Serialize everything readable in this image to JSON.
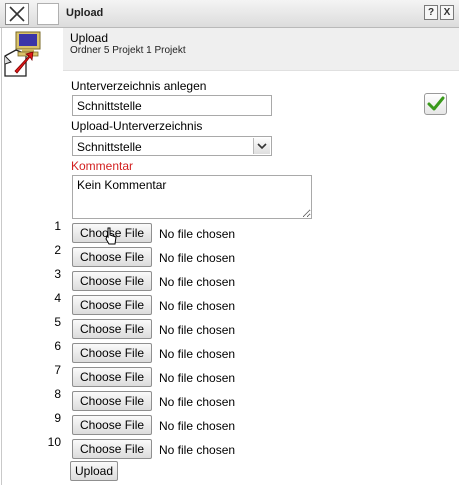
{
  "window": {
    "title": "Upload",
    "help_label": "?",
    "close_label": "X"
  },
  "header": {
    "title": "Upload",
    "subtitle": "Ordner 5 Projekt 1 Projekt"
  },
  "form": {
    "subdir_label": "Unterverzeichnis anlegen",
    "subdir_value": "Schnittstelle",
    "upload_subdir_label": "Upload-Unterverzeichnis",
    "upload_subdir_selected": "Schnittstelle",
    "comment_label": "Kommentar",
    "comment_value": "Kein Kommentar",
    "file_rows": [
      {
        "num": "1",
        "button": "Choose File",
        "status": "No file chosen"
      },
      {
        "num": "2",
        "button": "Choose File",
        "status": "No file chosen"
      },
      {
        "num": "3",
        "button": "Choose File",
        "status": "No file chosen"
      },
      {
        "num": "4",
        "button": "Choose File",
        "status": "No file chosen"
      },
      {
        "num": "5",
        "button": "Choose File",
        "status": "No file chosen"
      },
      {
        "num": "6",
        "button": "Choose File",
        "status": "No file chosen"
      },
      {
        "num": "7",
        "button": "Choose File",
        "status": "No file chosen"
      },
      {
        "num": "8",
        "button": "Choose File",
        "status": "No file chosen"
      },
      {
        "num": "9",
        "button": "Choose File",
        "status": "No file chosen"
      },
      {
        "num": "10",
        "button": "Choose File",
        "status": "No file chosen"
      }
    ],
    "submit_label": "Upload"
  },
  "icons": {
    "close": "close-icon",
    "help": "help-icon",
    "upload": "upload-computer-icon",
    "confirm": "checkmark-icon",
    "dropdown": "chevron-down-icon",
    "cursor": "mouse-pointer-icon"
  },
  "colors": {
    "accent_red": "#d21f1f",
    "check_green": "#3a9a1c",
    "header_bg": "#efefef"
  }
}
